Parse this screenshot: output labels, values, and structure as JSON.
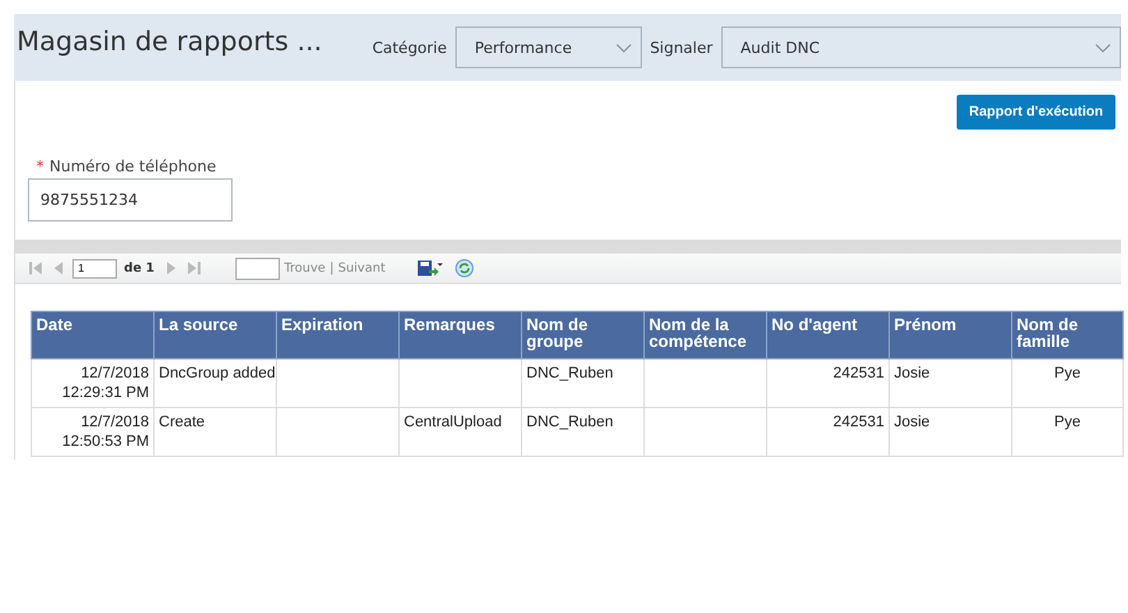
{
  "header": {
    "title": "Magasin de rapports ...",
    "category": {
      "label": "Catégorie",
      "value": "Performance"
    },
    "report": {
      "label": "Signaler",
      "value": "Audit DNC"
    }
  },
  "run_button": "Rapport d'exécution",
  "phone_field": {
    "required_mark": "*",
    "label": "Numéro de téléphone",
    "value": "9875551234"
  },
  "toolbar": {
    "page": "1",
    "of": "de 1",
    "find": "Trouve",
    "separator": "|",
    "next": "Suivant"
  },
  "table": {
    "columns": [
      "Date",
      "La source",
      "Expiration",
      "Remarques",
      "Nom de groupe",
      "Nom de la compétence",
      "No d'agent",
      "Prénom",
      "Nom de famille"
    ],
    "rows": [
      [
        "12/7/2018 12:29:31 PM",
        "DncGroup added",
        "",
        "",
        "DNC_Ruben",
        "",
        "242531",
        "Josie",
        "Pye"
      ],
      [
        "12/7/2018 12:50:53 PM",
        "Create",
        "",
        "CentralUpload",
        "DNC_Ruben",
        "",
        "242531",
        "Josie",
        "Pye"
      ]
    ]
  }
}
